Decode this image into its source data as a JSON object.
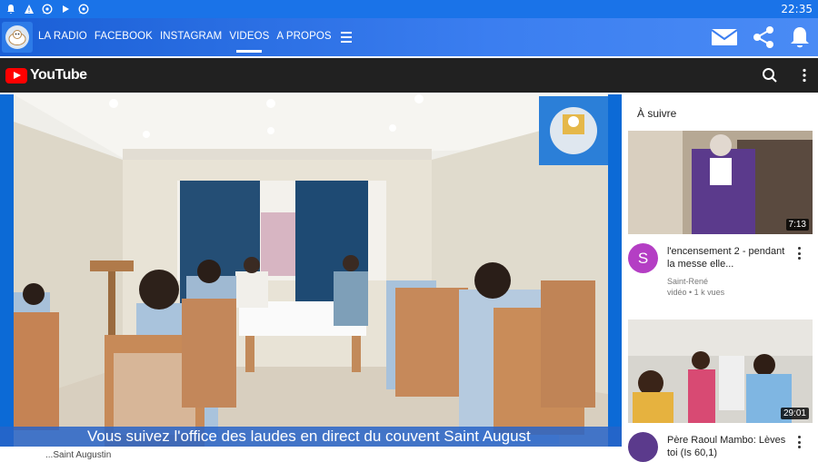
{
  "status_bar": {
    "time": "22:35",
    "icons": [
      "bell-icon",
      "warning-icon",
      "whatsapp-icon",
      "play-icon",
      "whatsapp-icon"
    ]
  },
  "app_bar": {
    "nav": [
      {
        "label": "LA RADIO"
      },
      {
        "label": "FACEBOOK"
      },
      {
        "label": "INSTAGRAM"
      },
      {
        "label": "VIDEOS",
        "active": true
      },
      {
        "label": "A PROPOS"
      }
    ],
    "actions": [
      "mail-icon",
      "share-icon",
      "bell-icon"
    ]
  },
  "youtube": {
    "brand": "YouTube",
    "actions": [
      "search-icon",
      "more-vert-icon"
    ]
  },
  "player": {
    "caption": "Vous suivez l'office des laudes en direct du couvent Saint August",
    "accent": "#0c6ad6"
  },
  "up_next": {
    "heading": "À suivre",
    "videos": [
      {
        "duration": "7:13",
        "avatar_letter": "S",
        "title": "l'encensement 2 - pendant la messe elle...",
        "channel": "Saint-René",
        "stats": "vidéo • 1 k vues"
      },
      {
        "duration": "29:01",
        "title": "Père Raoul Mambo: Lèves toi (Is 60,1)"
      }
    ]
  },
  "below_video": {
    "text": "...Saint Augustin"
  }
}
